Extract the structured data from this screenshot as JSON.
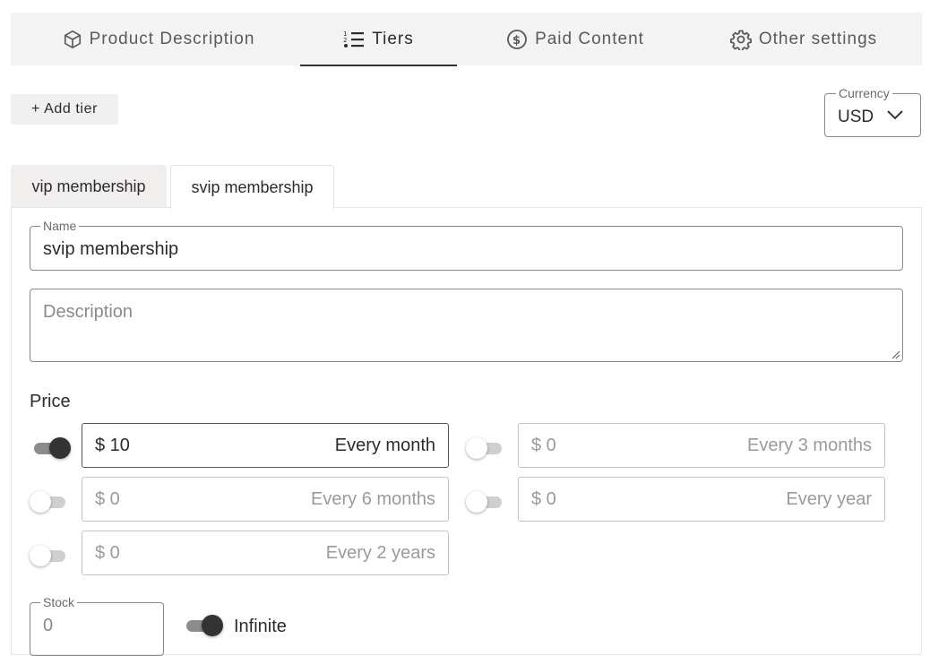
{
  "tabs": [
    {
      "label": "Product Description",
      "icon": "cube-icon"
    },
    {
      "label": "Tiers",
      "icon": "list-icon"
    },
    {
      "label": "Paid Content",
      "icon": "dollar-circle-icon"
    },
    {
      "label": "Other settings",
      "icon": "gear-icon"
    }
  ],
  "active_tab": "Tiers",
  "add_tier_label": "+ Add tier",
  "currency": {
    "label": "Currency",
    "value": "USD"
  },
  "tier_tabs": [
    {
      "label": "vip membership",
      "active": false
    },
    {
      "label": "svip membership",
      "active": true
    }
  ],
  "form": {
    "name_label": "Name",
    "name_value": "svip membership",
    "description_placeholder": "Description",
    "price_label": "Price",
    "prices": [
      {
        "amount": "$ 10",
        "period": "Every month",
        "enabled": true
      },
      {
        "amount": "$ 0",
        "period": "Every 3 months",
        "enabled": false
      },
      {
        "amount": "$ 0",
        "period": "Every 6 months",
        "enabled": false
      },
      {
        "amount": "$ 0",
        "period": "Every year",
        "enabled": false
      },
      {
        "amount": "$ 0",
        "period": "Every 2 years",
        "enabled": false
      }
    ],
    "stock_label": "Stock",
    "stock_value": "0",
    "infinite_label": "Infinite",
    "infinite_enabled": true
  },
  "colors": {
    "accent": "#333333",
    "tab_bar_bg": "#f3f3f3",
    "inactive_tab_bg": "#f1eeee"
  }
}
